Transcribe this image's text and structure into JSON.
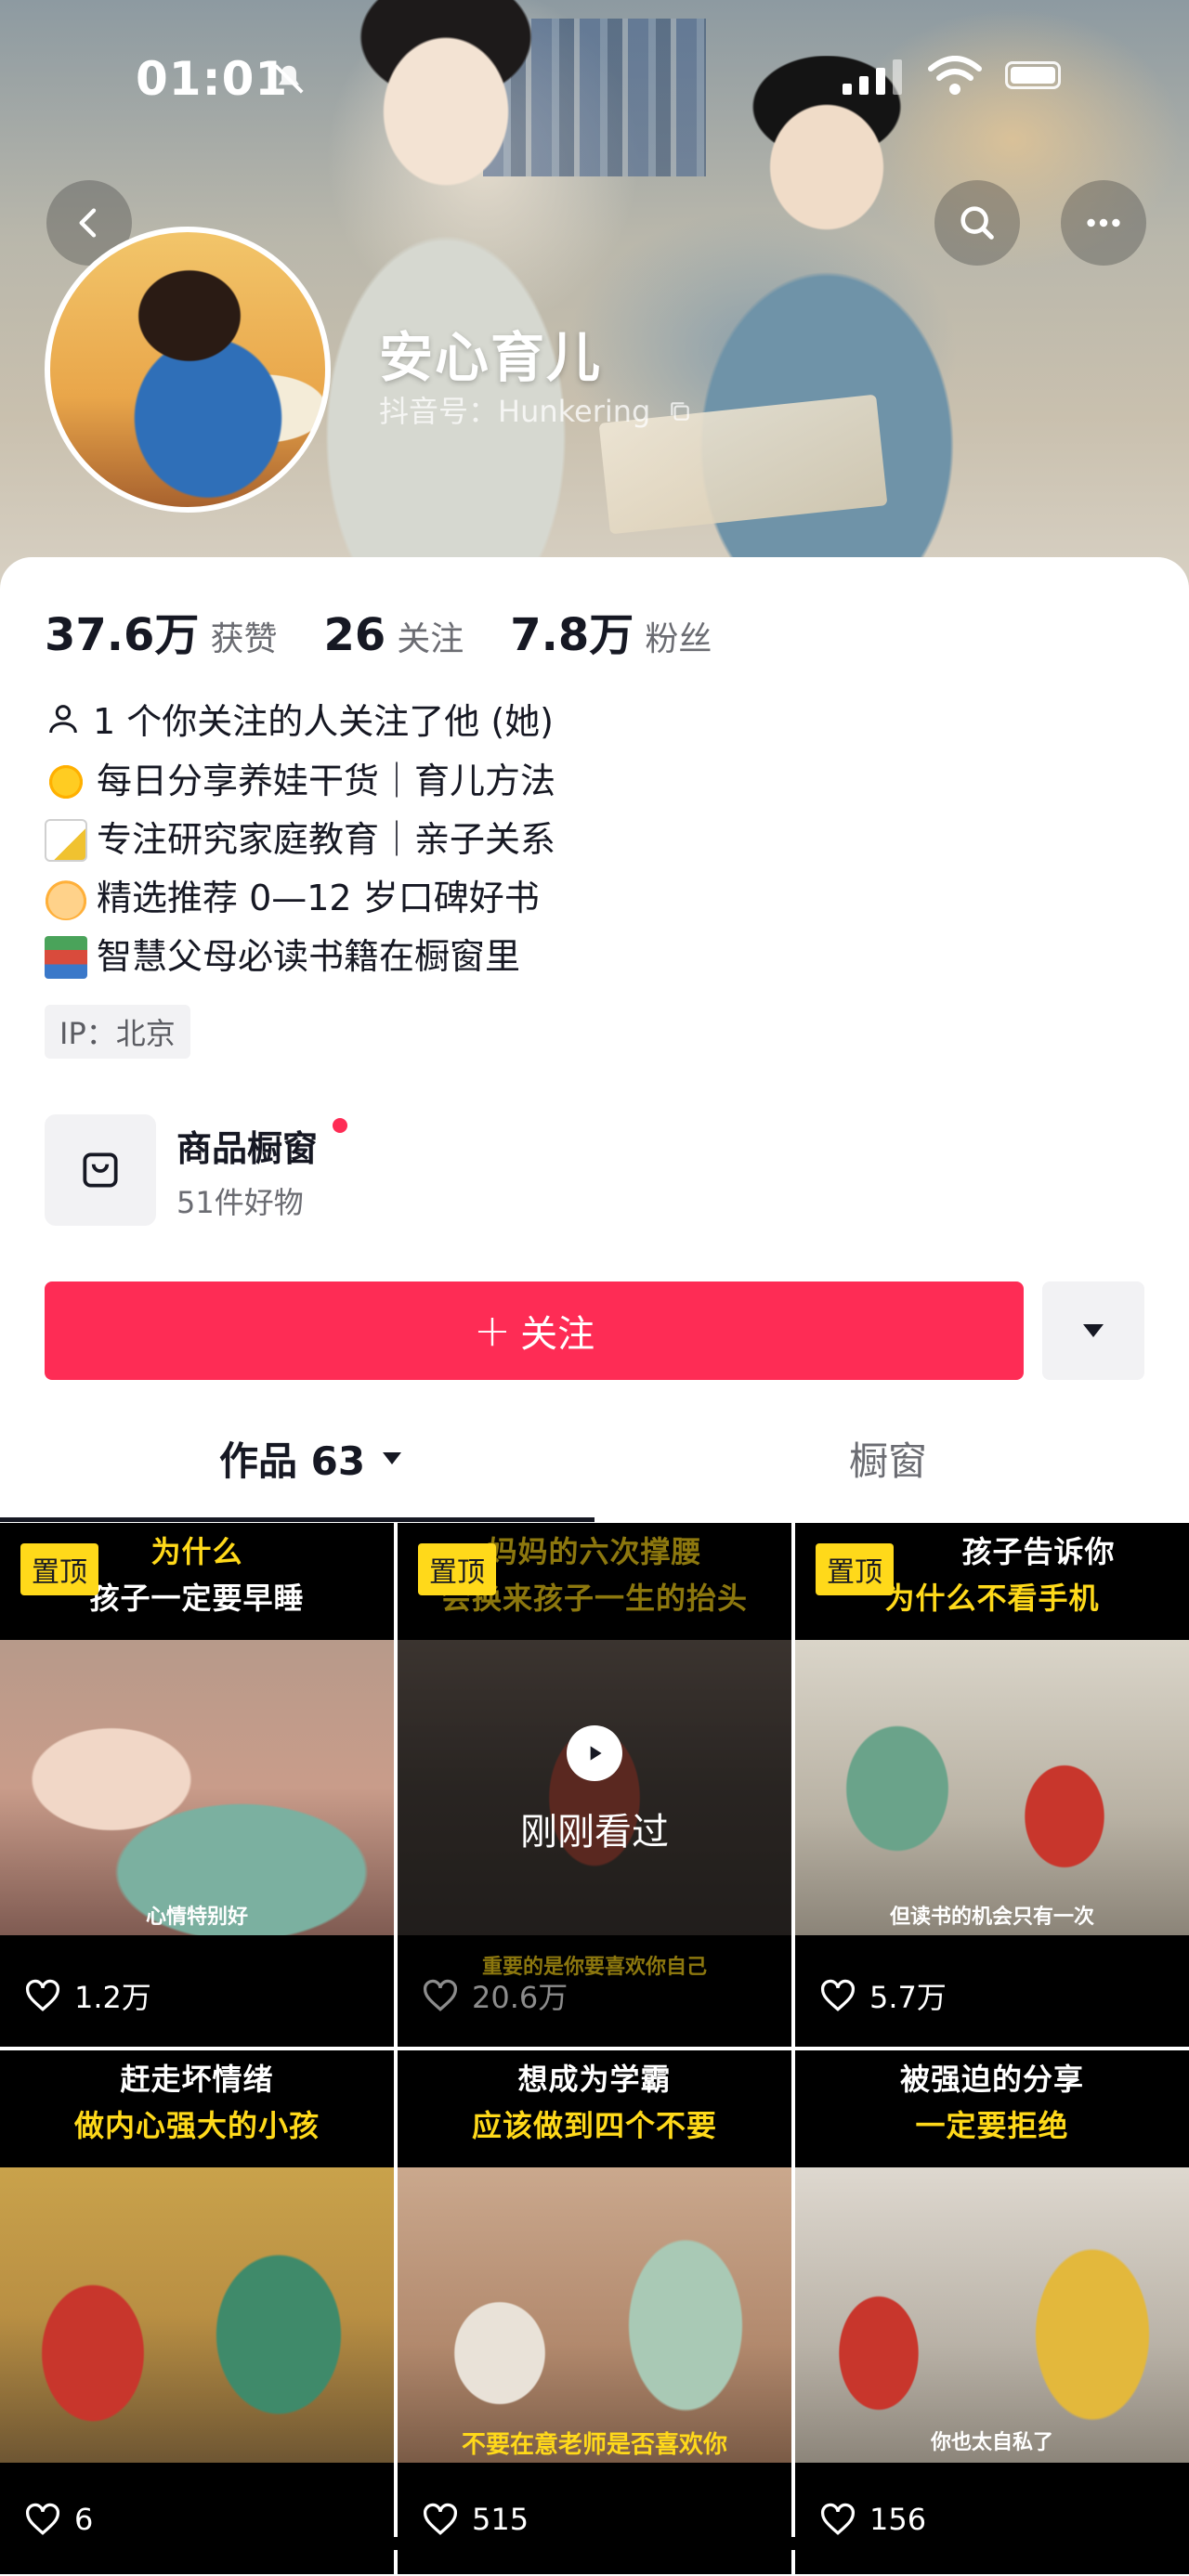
{
  "status_bar": {
    "time": "01:01"
  },
  "profile": {
    "nickname": "安心育儿",
    "douyin_id_label": "抖音号：Hunkering",
    "stats": [
      {
        "value": "37.6万",
        "label": "获赞"
      },
      {
        "value": "26",
        "label": "关注"
      },
      {
        "value": "7.8万",
        "label": "粉丝"
      }
    ],
    "mutual_follow": "1 个你关注的人关注了他 (她)",
    "bio_lines": [
      "每日分享养娃干货｜育儿方法",
      "专注研究家庭教育｜亲子关系",
      "精选推荐 0—12 岁口碑好书",
      "智慧父母必读书籍在橱窗里"
    ],
    "ip_location": "IP：北京"
  },
  "shop": {
    "title": "商品橱窗",
    "subtitle": "51件好物"
  },
  "follow_button": {
    "plus": "+",
    "label": "关注"
  },
  "tabs": {
    "works": "作品 63",
    "shop": "橱窗"
  },
  "videos": [
    {
      "pinned_label": "置顶",
      "caption_line1": "为什么",
      "caption_line2": "孩子一定要早睡",
      "subtitle": "心情特别好",
      "likes": "1.2万"
    },
    {
      "pinned_label": "置顶",
      "caption_line1": "妈妈的六次撑腰",
      "caption_line2": "会换来孩子一生的抬头",
      "subtitle": "重要的是你要喜欢你自己",
      "likes": "20.6万",
      "overlay": "刚刚看过"
    },
    {
      "pinned_label": "置顶",
      "caption_line1": "孩子告诉你",
      "caption_line2": "为什么不看手机",
      "subtitle": "但读书的机会只有一次",
      "likes": "5.7万"
    },
    {
      "caption_line1": "赶走坏情绪",
      "caption_line2": "做内心强大的小孩",
      "subtitle": "",
      "likes": "6"
    },
    {
      "caption_line1": "想成为学霸",
      "caption_line2": "应该做到四个不要",
      "subtitle": "不要在意老师是否喜欢你",
      "likes": "515"
    },
    {
      "caption_line1": "被强迫的分享",
      "caption_line2": "一定要拒绝",
      "subtitle": "你也太自私了",
      "likes": "156"
    }
  ],
  "colors": {
    "accent": "#fe2c55",
    "pin_yellow": "#ffd91a"
  }
}
